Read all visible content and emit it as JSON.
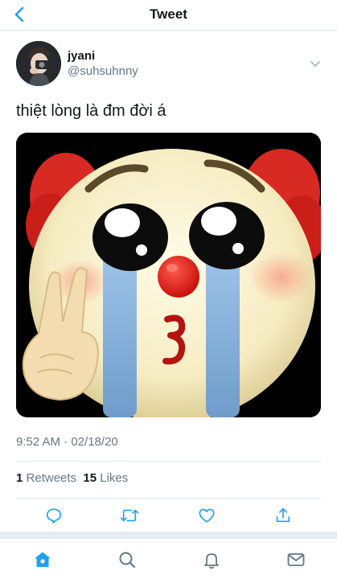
{
  "header": {
    "title": "Tweet",
    "back_icon": "chevron-left-icon"
  },
  "tweet": {
    "author": {
      "display_name": "jyani",
      "handle": "@suhsuhnny"
    },
    "text": "thiệt lòng là đm đời á",
    "timestamp": "9:52 AM · 02/18/20",
    "stats": {
      "retweets_count": "1",
      "retweets_label": "Retweets",
      "likes_count": "15",
      "likes_label": "Likes"
    },
    "actions": [
      "reply-icon",
      "retweet-icon",
      "like-icon",
      "share-icon"
    ]
  },
  "tabbar": {
    "items": [
      "home-icon",
      "search-icon",
      "notifications-icon",
      "messages-icon"
    ],
    "active": "home-icon"
  },
  "colors": {
    "accent": "#1da1f2",
    "text": "#14171a",
    "secondary": "#657786",
    "border": "#e1e8ed"
  }
}
